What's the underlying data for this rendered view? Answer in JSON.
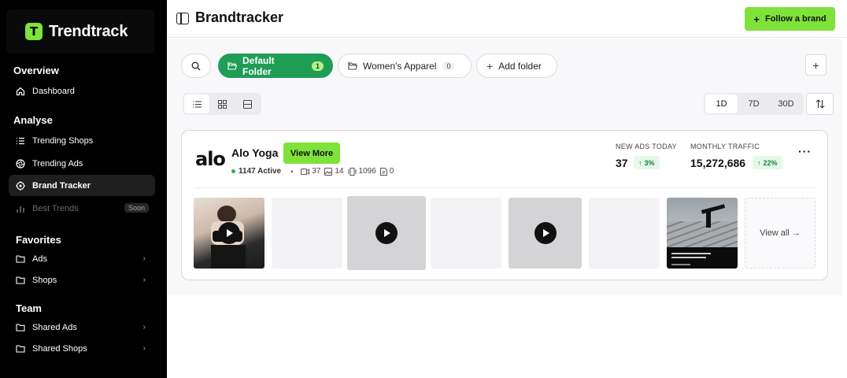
{
  "sidebar": {
    "logo_text": "Trendtrack",
    "sections": {
      "overview": "Overview",
      "analyse": "Analyse",
      "favorites": "Favorites",
      "team": "Team"
    },
    "items": {
      "dashboard": "Dashboard",
      "trending_shops": "Trending Shops",
      "trending_ads": "Trending Ads",
      "brand_tracker": "Brand Tracker",
      "best_trends": "Best Trends",
      "best_trends_badge": "Soon",
      "ads": "Ads",
      "shops": "Shops",
      "shared_ads": "Shared Ads",
      "shared_shops": "Shared Shops"
    }
  },
  "header": {
    "title": "Brandtracker",
    "follow_label": "Follow a brand"
  },
  "folders": [
    {
      "label": "Default Folder",
      "count": "1",
      "active": true
    },
    {
      "label": "Women's Apparel",
      "count": "0",
      "active": false
    }
  ],
  "add_folder_label": "Add folder",
  "time_range": {
    "options": [
      "1D",
      "7D",
      "30D"
    ],
    "selected": "1D"
  },
  "brand": {
    "logo_text": "alo",
    "name": "Alo Yoga",
    "view_more_label": "View More",
    "active_count": "1147 Active",
    "videos": "37",
    "images": "14",
    "carousels": "1096",
    "docs": "0",
    "new_ads_label": "NEW ADS TODAY",
    "new_ads_value": "37",
    "new_ads_change": "3%",
    "traffic_label": "MONTHLY TRAFFIC",
    "traffic_value": "15,272,686",
    "traffic_change": "22%",
    "view_all_label": "View all →"
  },
  "colors": {
    "accent_green": "#7ee23a",
    "folder_active": "#1f9d55",
    "sidebar_bg": "#000000"
  }
}
